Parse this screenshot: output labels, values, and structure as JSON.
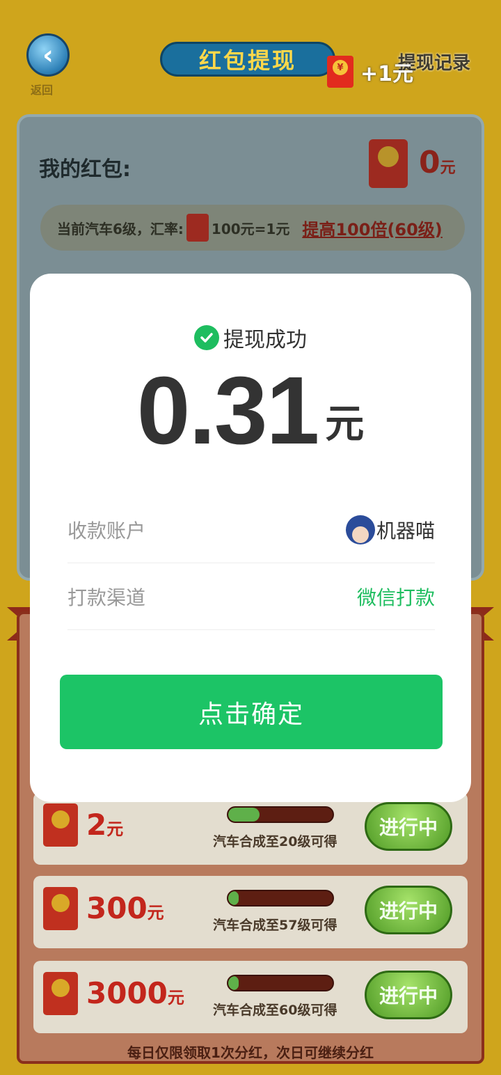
{
  "header": {
    "back_label": "返回",
    "title": "红包提现",
    "history_link": "提现记录",
    "reward_toast": "+1元"
  },
  "wallet": {
    "label": "我的红包:",
    "amount": "0",
    "unit": "元",
    "rate_text_1": "当前汽车6级，汇率:",
    "rate_text_2": "100元=1元",
    "boost_link": "提高100倍(60级)"
  },
  "tasks": [
    {
      "amount": "2",
      "unit": "元",
      "condition": "汽车合成至20级可得",
      "button": "进行中",
      "progress": 0.3
    },
    {
      "amount": "300",
      "unit": "元",
      "condition": "汽车合成至57级可得",
      "button": "进行中",
      "progress": 0.1
    },
    {
      "amount": "3000",
      "unit": "元",
      "condition": "汽车合成至60级可得",
      "button": "进行中",
      "progress": 0.1
    }
  ],
  "footer_note": "每日仅限领取1次分红，次日可继续分红",
  "modal": {
    "status": "提现成功",
    "amount": "0.31",
    "unit": "元",
    "account_label": "收款账户",
    "account_name": "机器喵",
    "channel_label": "打款渠道",
    "channel_value": "微信打款",
    "confirm_button": "点击确定"
  },
  "colors": {
    "accent_green": "#1cc466",
    "success_green": "#1ebd5f",
    "text_dark": "#333333",
    "text_gray": "#999999"
  },
  "icons": [
    "back-arrow-icon",
    "red-packet-icon",
    "check-circle-icon",
    "avatar-icon"
  ]
}
